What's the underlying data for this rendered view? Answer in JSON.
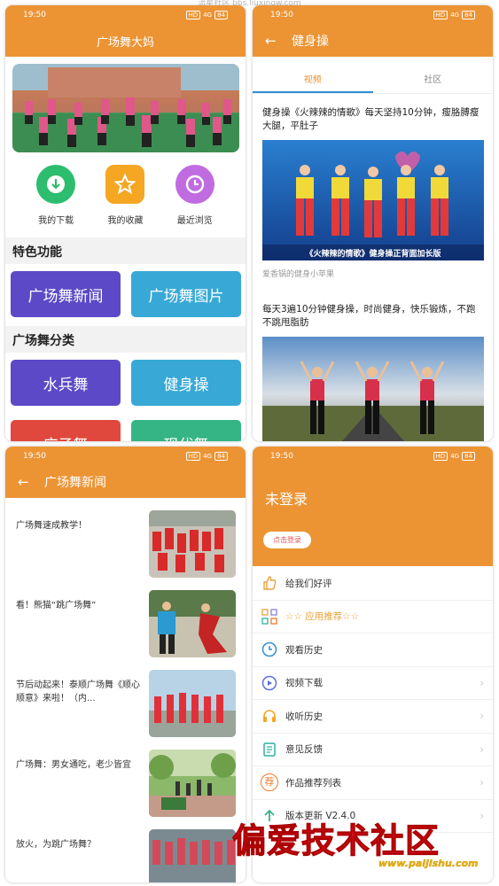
{
  "watermark_top": "流星社区 bbs.liuxingw.com",
  "status": {
    "time": "19:50",
    "network": "HD",
    "signal": "4G",
    "battery": "84"
  },
  "home": {
    "title": "广场舞大妈",
    "quick": [
      {
        "label": "我的下载",
        "icon": "download-icon",
        "color": "#2dbd6e"
      },
      {
        "label": "我的收藏",
        "icon": "star-icon",
        "color": "#f5a623"
      },
      {
        "label": "最近浏览",
        "icon": "history-icon",
        "color": "#c06be0"
      }
    ],
    "features_title": "特色功能",
    "features": [
      {
        "label": "广场舞新闻",
        "color": "#5b49c7"
      },
      {
        "label": "广场舞图片",
        "color": "#38a9d6"
      }
    ],
    "categories_title": "广场舞分类",
    "categories": [
      {
        "label": "水兵舞",
        "color": "#5b49c7"
      },
      {
        "label": "健身操",
        "color": "#38a9d6"
      },
      {
        "label": "広子舞",
        "color": "#e0483e"
      },
      {
        "label": "现代舞",
        "color": "#35b585"
      }
    ]
  },
  "fitness": {
    "title": "健身操",
    "tabs": [
      "视频",
      "社区"
    ],
    "videos": [
      {
        "title": "健身操《火辣辣的情歌》每天坚持10分钟，瘦胳膊瘦大腿，平肚子",
        "caption": "《火辣辣的情歌》健身操正背面加长版",
        "author": "爱香锅的健身小苹果"
      },
      {
        "title": "每天3遍10分钟健身操，时尚健身，快乐锻炼，不跑不跳甩脂肪",
        "caption": "",
        "author": ""
      }
    ]
  },
  "news": {
    "title": "广场舞新闻",
    "items": [
      {
        "title": "广场舞速成教学！"
      },
      {
        "title": "看！熊猫“跳广场舞”"
      },
      {
        "title": "节后动起来！泰顺广场舞《顺心顺意》来啦！（内..."
      },
      {
        "title": "广场舞：男女通吃，老少皆宜"
      },
      {
        "title": "放火，为跳广场舞？"
      }
    ]
  },
  "profile": {
    "title": "未登录",
    "login_button": "点击登录",
    "menu": [
      {
        "label": "给我们好评",
        "icon": "thumb-icon",
        "color": "#e8a33a",
        "chevron": false
      },
      {
        "label": "☆☆ 应用推荐☆☆",
        "icon": "apps-icon",
        "color": "#e8a33a",
        "chevron": false,
        "highlight": true
      },
      {
        "label": "观看历史",
        "icon": "clock-icon",
        "color": "#2f8fd6",
        "chevron": false
      },
      {
        "label": "视频下载",
        "icon": "video-download-icon",
        "color": "#5b6fe0",
        "chevron": true
      },
      {
        "label": "收听历史",
        "icon": "headphones-icon",
        "color": "#f5a623",
        "chevron": true
      },
      {
        "label": "意见反馈",
        "icon": "feedback-icon",
        "color": "#2db3a0",
        "chevron": true
      },
      {
        "label": "作品推荐列表",
        "icon": "recommend-icon",
        "color": "#f07a2a",
        "chevron": true,
        "badge": "荐"
      },
      {
        "label": "版本更新 V2.4.0",
        "icon": "update-icon",
        "color": "#35b585",
        "chevron": true
      }
    ]
  },
  "watermark": {
    "main": "偏爱技术社区",
    "sub": "www.paijishu.com"
  }
}
